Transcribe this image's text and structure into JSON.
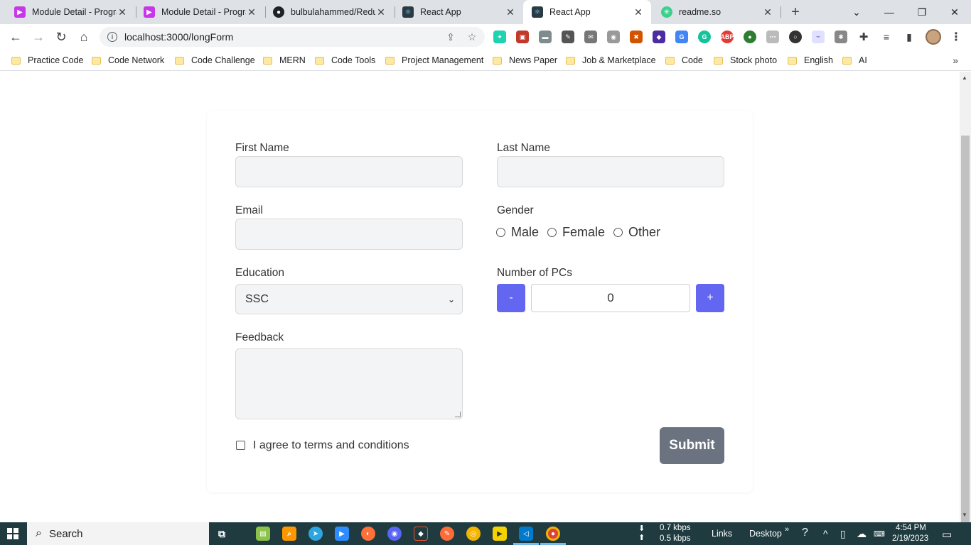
{
  "tabs": [
    {
      "label": "Module Detail - Programming Hero",
      "favicon": "programming-hero-icon",
      "color": "#c736e8",
      "active": false
    },
    {
      "label": "Module Detail - Programming Hero",
      "favicon": "programming-hero-icon",
      "color": "#c736e8",
      "active": false
    },
    {
      "label": "bulbulahammed/Redux",
      "favicon": "github-icon",
      "color": "#202124",
      "active": false
    },
    {
      "label": "React App",
      "favicon": "react-icon",
      "color": "#2b3a42",
      "active": false
    },
    {
      "label": "React App",
      "favicon": "react-icon",
      "color": "#2b3a42",
      "active": true
    },
    {
      "label": "readme.so",
      "favicon": "readme-icon",
      "color": "#3ecf8e",
      "active": false
    }
  ],
  "toolbar": {
    "url": "localhost:3000/longForm"
  },
  "bookmarks": [
    "Practice Code",
    "Code Network",
    "Code Challenge",
    "MERN",
    "Code Tools",
    "Project Management",
    "News Paper",
    "Job & Marketplace",
    "Code",
    "Stock photo",
    "English",
    "AI"
  ],
  "form": {
    "first_name_label": "First Name",
    "last_name_label": "Last Name",
    "email_label": "Email",
    "gender_label": "Gender",
    "gender_options": [
      "Male",
      "Female",
      "Other"
    ],
    "education_label": "Education",
    "education_value": "SSC",
    "pcs_label": "Number of PCs",
    "pcs_minus": "-",
    "pcs_plus": "+",
    "pcs_value": "0",
    "feedback_label": "Feedback",
    "agree_label": "I agree to terms and conditions",
    "submit_label": "Submit",
    "accent_color": "#6366f1",
    "submit_color": "#6b7280"
  },
  "taskbar": {
    "search_label": "Search",
    "net_down": "0.7 kbps",
    "net_up": "0.5 kbps",
    "links_label": "Links",
    "desktop_label": "Desktop",
    "time": "4:54 PM",
    "date": "2/19/2023"
  }
}
